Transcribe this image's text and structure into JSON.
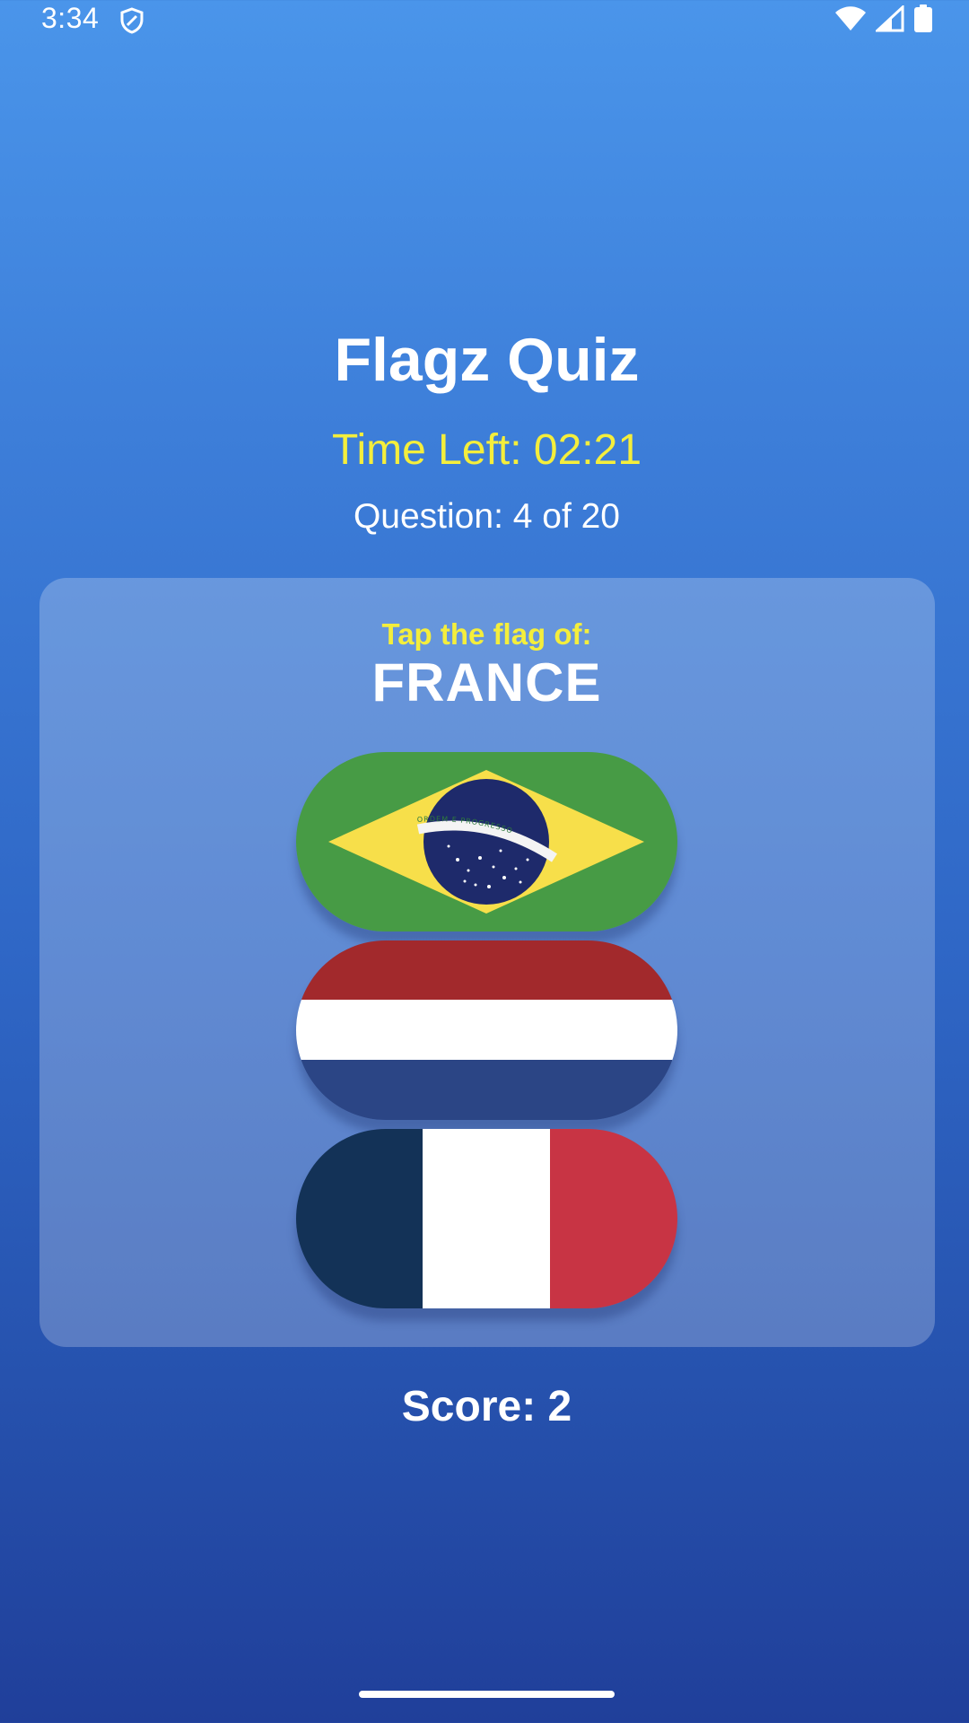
{
  "status_bar": {
    "time": "3:34",
    "icons": [
      "shield-icon",
      "wifi-icon",
      "cellular-signal-icon",
      "battery-icon"
    ]
  },
  "quiz": {
    "title": "Flagz Quiz",
    "timer_text": "Time Left: 02:21",
    "question_text": "Question: 4 of 20",
    "prompt_label": "Tap the flag of:",
    "country": "FRANCE",
    "score_text": "Score: 2"
  },
  "options": [
    {
      "flag": "brazil-flag",
      "banner_text": "ORDEM E PROGRESSO"
    },
    {
      "flag": "netherlands-flag"
    },
    {
      "flag": "france-flag"
    }
  ],
  "colors": {
    "accent_yellow": "#f4ee3c",
    "text": "#ffffff",
    "background_top": "#4a95ea",
    "background_bottom": "#203f9a"
  }
}
